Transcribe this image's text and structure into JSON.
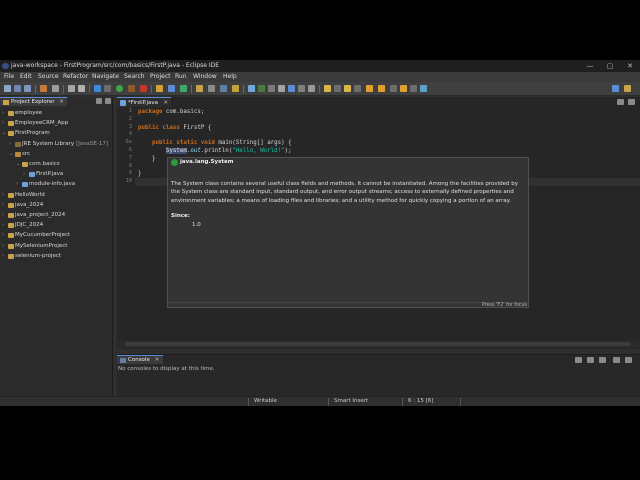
{
  "window": {
    "title": "java-workspace - FirstProgram/src/com/basics/FirstP.java - Eclipse IDE",
    "minimize": "—",
    "maximize": "▢",
    "close": "✕"
  },
  "menu": [
    "File",
    "Edit",
    "Source",
    "Refactor",
    "Navigate",
    "Search",
    "Project",
    "Run",
    "Window",
    "Help"
  ],
  "explorer": {
    "title": "Project Explorer",
    "close": "✕",
    "tree": [
      {
        "label": "employee",
        "suffix": "",
        "depth": 0,
        "twisty": "›",
        "icon": "project-icon"
      },
      {
        "label": "EmployeeCRM_App",
        "suffix": "",
        "depth": 0,
        "twisty": "›",
        "icon": "project-icon"
      },
      {
        "label": "FirstProgram",
        "suffix": "",
        "depth": 0,
        "twisty": "⌄",
        "icon": "project-icon"
      },
      {
        "label": "JRE System Library",
        "suffix": "[JavaSE-17]",
        "depth": 1,
        "twisty": "›",
        "icon": "library-icon"
      },
      {
        "label": "src",
        "suffix": "",
        "depth": 1,
        "twisty": "⌄",
        "icon": "source-folder-icon"
      },
      {
        "label": "com.basics",
        "suffix": "",
        "depth": 2,
        "twisty": "⌄",
        "icon": "package-icon"
      },
      {
        "label": "FirstP.java",
        "suffix": "",
        "depth": 3,
        "twisty": "›",
        "icon": "java-file-icon"
      },
      {
        "label": "module-info.java",
        "suffix": "",
        "depth": 2,
        "twisty": "›",
        "icon": "java-file-icon"
      },
      {
        "label": "HelloWorld",
        "suffix": "",
        "depth": 0,
        "twisty": "›",
        "icon": "project-icon"
      },
      {
        "label": "java_2024",
        "suffix": "",
        "depth": 0,
        "twisty": "›",
        "icon": "project-icon"
      },
      {
        "label": "java_project_2024",
        "suffix": "",
        "depth": 0,
        "twisty": "›",
        "icon": "project-icon"
      },
      {
        "label": "JDJC_2024",
        "suffix": "",
        "depth": 0,
        "twisty": "›",
        "icon": "project-icon"
      },
      {
        "label": "MyCucumberProject",
        "suffix": "",
        "depth": 0,
        "twisty": "›",
        "icon": "project-icon"
      },
      {
        "label": "MySeleniumProject",
        "suffix": "",
        "depth": 0,
        "twisty": "›",
        "icon": "project-icon"
      },
      {
        "label": "selenium-project",
        "suffix": "",
        "depth": 0,
        "twisty": "›",
        "icon": "project-icon"
      }
    ]
  },
  "editor": {
    "tab_label": "*FirstP.java",
    "tab_close": "✕",
    "line_numbers": [
      "1",
      "2",
      "3",
      "4",
      "5⊖",
      "6",
      "7",
      "8",
      "9",
      "10"
    ],
    "code": {
      "l1_kw": "package",
      "l1_rest": " com.basics;",
      "l3_kw1": "public",
      "l3_kw2": "class",
      "l3_name": " FirstP {",
      "l5_kw1": "public",
      "l5_kw2": "static",
      "l5_kw3": "void",
      "l5_rest": " main(String[] args) {",
      "l6_cls": "System",
      "l6_dot": ".",
      "l6_fld": "out",
      "l6_call": ".println(",
      "l6_str": "\"Hello, World!\"",
      "l6_end": ");",
      "l7": "    }",
      "l9": "}"
    }
  },
  "hover": {
    "header": "java.lang.System",
    "description": "The System class contains several useful class fields and methods. It cannot be instantiated. Among the facilities provided by the System class are standard input, standard output, and error output streams; access to externally defined properties and environment variables; a means of loading files and libraries; and a utility method for quickly copying a portion of an array.",
    "since_label": "Since:",
    "since_value": "1.0",
    "footer": "Press 'F2' for focus"
  },
  "console": {
    "tab_label": "Console",
    "tab_close": "✕",
    "message": "No consoles to display at this time."
  },
  "status": {
    "mode": "Writable",
    "insert": "Smart Insert",
    "position": "6 : 15 [6]"
  },
  "colors": {
    "keyword": "#cc6c1d",
    "string": "#17c6a3",
    "field": "#8ddaf8",
    "accent": "#5a8dd6"
  }
}
